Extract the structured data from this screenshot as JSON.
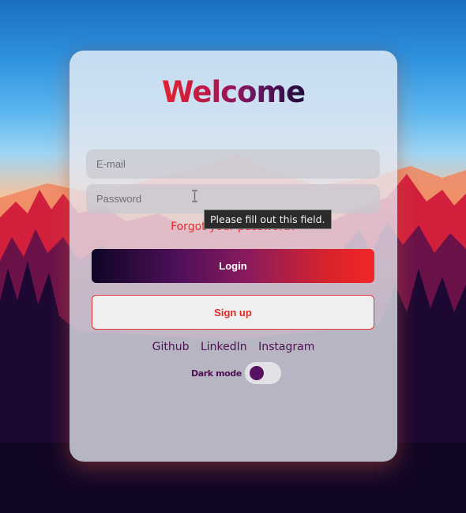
{
  "title": "Welcome",
  "form": {
    "email_placeholder": "E-mail",
    "password_placeholder": "Password",
    "forgot_label": "Forgot your password?",
    "login_label": "Login",
    "signup_label": "Sign up"
  },
  "links": [
    "Github",
    "LinkedIn",
    "Instagram"
  ],
  "dark_mode": {
    "label": "Dark mode",
    "enabled": false
  },
  "tooltip": "Please fill out this field.",
  "colors": {
    "accent_red": "#e62a2a",
    "accent_purple": "#4e1152",
    "login_gradient_start": "#0e0526",
    "login_gradient_end": "#f42626"
  },
  "icons": [
    "text-cursor-icon"
  ]
}
